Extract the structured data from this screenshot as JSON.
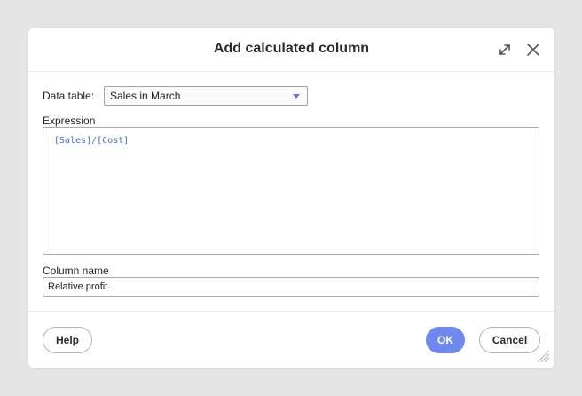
{
  "dialog": {
    "title": "Add calculated column",
    "expand_icon": "expand-arrows-icon",
    "close_icon": "close-x-icon"
  },
  "data_table": {
    "label": "Data table:",
    "value": "Sales in March"
  },
  "expression": {
    "label": "Expression",
    "value": "[Sales]/[Cost]"
  },
  "column_name": {
    "label": "Column name",
    "value": "Relative profit"
  },
  "buttons": {
    "help": "Help",
    "ok": "OK",
    "cancel": "Cancel"
  },
  "colors": {
    "accent": "#6f89ee",
    "expression_text": "#4a6ccf",
    "backdrop": "#e5e5e5"
  }
}
